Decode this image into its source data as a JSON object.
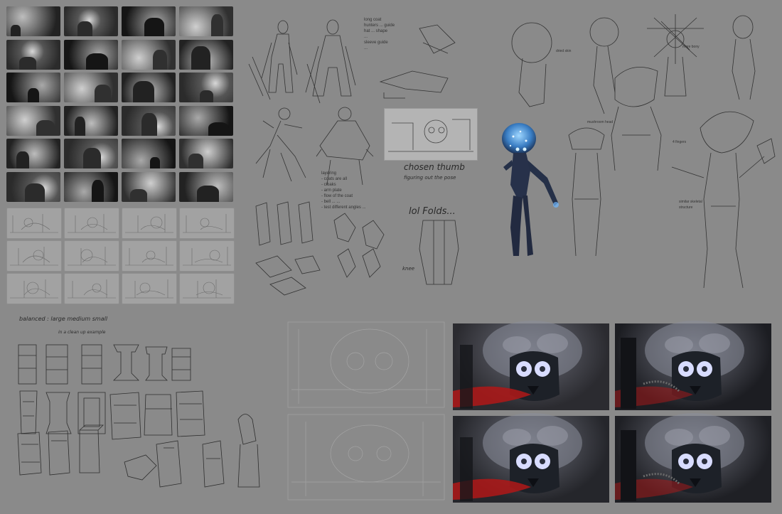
{
  "page": {
    "background": "#8a8a8a"
  },
  "storyboard_value": {
    "count": 24,
    "dark": "#1e1e1e",
    "mid": "#5a5a5a",
    "light": "#c8c8c8"
  },
  "storyboard_lines": {
    "count": 12
  },
  "character_notes": {
    "design_list": [
      "long coat",
      "hunters ... guide",
      "hat ... shape",
      "...",
      "sleeve guide",
      "..."
    ],
    "armor_list": [
      "layering",
      "- coats are all",
      "- cloaks",
      "- arm plate",
      "- flow of the coat",
      "- bell ... ...",
      "- test different angles ..."
    ],
    "fold_label": "lol Folds...",
    "chosen_thumb": "chosen thumb",
    "figuring_out": "figuring out the pose",
    "knee_label": "knee"
  },
  "creature_notes": {
    "label1": "dried skin",
    "label2": "more bony",
    "label3": "mushroom head",
    "label4": "4 fingers",
    "label5": "similar skeletal structure"
  },
  "props_notes": {
    "heading": "balanced : large  medium  small",
    "sub": "in a clean up example"
  },
  "renders": {
    "count": 4,
    "accent": "#b01818",
    "glow": "#d8dcff"
  },
  "creature_glow": "#6fb8ff"
}
